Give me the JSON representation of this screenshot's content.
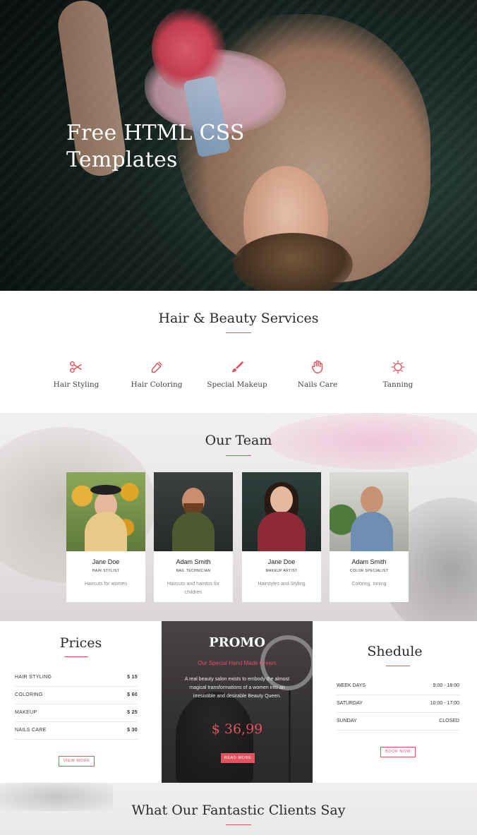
{
  "hero": {
    "title": "Free HTML CSS Templates"
  },
  "services": {
    "title": "Hair & Beauty Services",
    "items": [
      {
        "label": "Hair Styling",
        "icon": "scissors-icon"
      },
      {
        "label": "Hair Coloring",
        "icon": "dropper-icon"
      },
      {
        "label": "Special Makeup",
        "icon": "brush-icon"
      },
      {
        "label": "Nails Care",
        "icon": "hand-icon"
      },
      {
        "label": "Tanning",
        "icon": "sun-icon"
      }
    ]
  },
  "team": {
    "title": "Our Team",
    "members": [
      {
        "name": "Jane Doe",
        "role": "HAIR STYLIST",
        "desc": "Haircuts for women"
      },
      {
        "name": "Adam Smith",
        "role": "NAIL TECHNICIAN",
        "desc": "Haircuts and hairdos for children"
      },
      {
        "name": "Jane Doe",
        "role": "MAKEUP ARTIST",
        "desc": "Hairstyles and Styling"
      },
      {
        "name": "Adam Smith",
        "role": "COLOR SPECIALIST",
        "desc": "Coloring, toning"
      }
    ]
  },
  "prices": {
    "title": "Prices",
    "rows": [
      {
        "label": "HAIR STYLING",
        "value": "$ 15"
      },
      {
        "label": "COLORING",
        "value": "$ 60"
      },
      {
        "label": "MAKEUP",
        "value": "$ 25"
      },
      {
        "label": "NAILS CARE",
        "value": "$ 30"
      }
    ],
    "button": "VIEW MORE"
  },
  "promo": {
    "title": "PROMO",
    "subtitle": "Our Special Hand Made Cream",
    "text": "A real beauty salon exists to embody the almost magical transformations of a women into an irresistible and desirable Beauty Queen.",
    "price": "$ 36,99",
    "button": "READ MORE"
  },
  "schedule": {
    "title": "Shedule",
    "rows": [
      {
        "label": "WEEK DAYS",
        "value": "9:00 - 18:00"
      },
      {
        "label": "SATURDAY",
        "value": "10:00 - 17:00"
      },
      {
        "label": "SUNDAY",
        "value": "CLOSED"
      }
    ],
    "button": "BOOK NOW"
  },
  "clients": {
    "title": "What Our Fantastic Clients Say"
  },
  "colors": {
    "accent": "#e0535f",
    "dark_panel": "#3b3839"
  }
}
